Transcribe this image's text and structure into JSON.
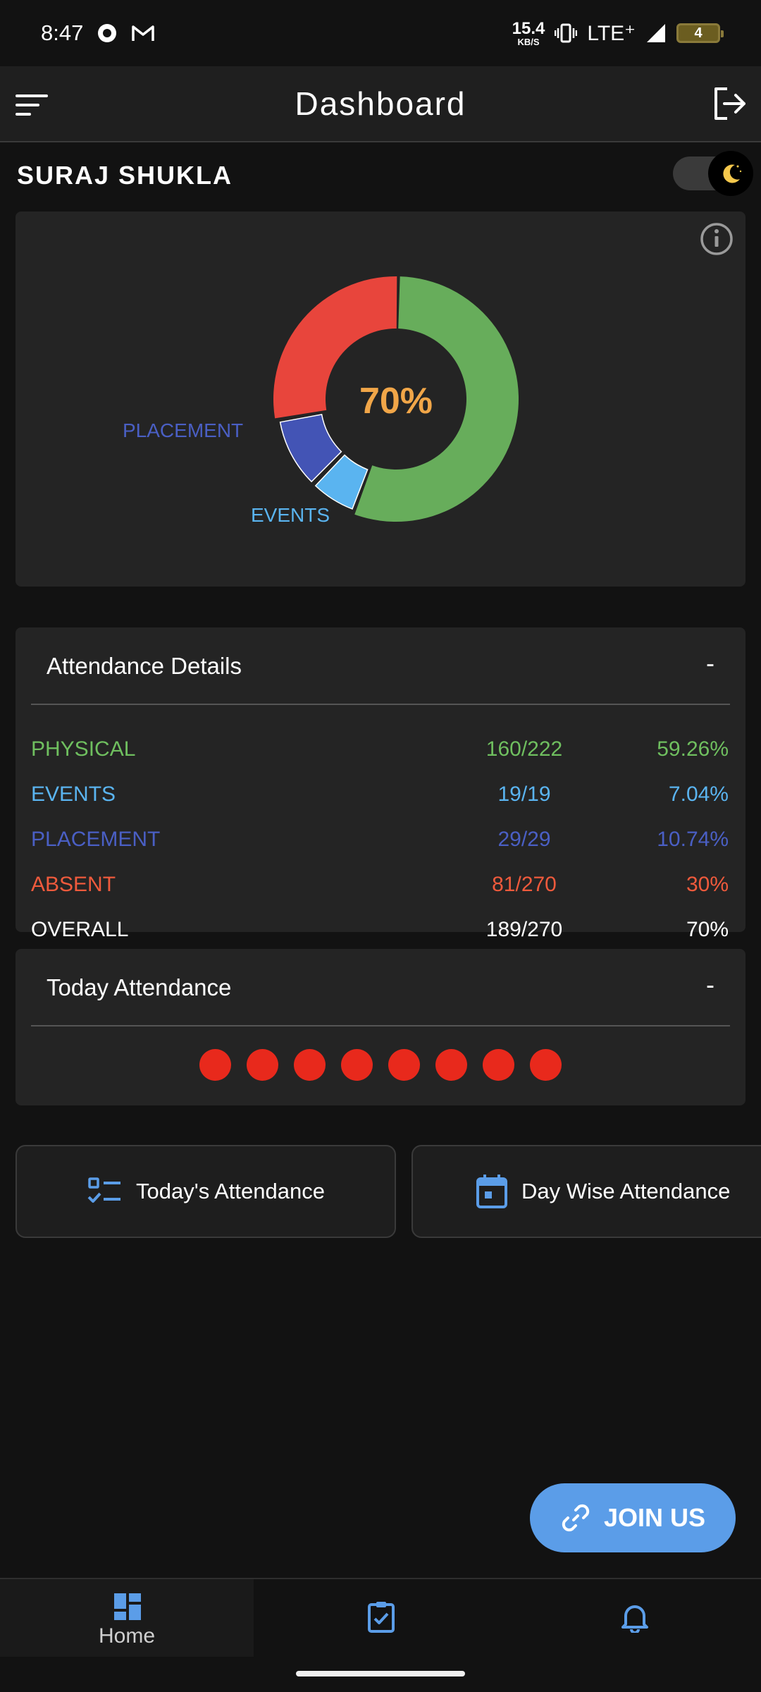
{
  "status_bar": {
    "time": "8:47",
    "net_speed_value": "15.4",
    "net_speed_unit": "KB/S",
    "network": "LTE⁺",
    "battery": "4"
  },
  "app_bar": {
    "title": "Dashboard"
  },
  "user": {
    "name": "SURAJ SHUKLA"
  },
  "chart_data": {
    "type": "pie",
    "center_label": "70%",
    "slices": [
      {
        "name": "PHYSICAL",
        "value": 59.26,
        "color": "#67ad5b",
        "labeled": false
      },
      {
        "name": "EVENTS",
        "value": 7.04,
        "color": "#5ab4f0",
        "labeled": true
      },
      {
        "name": "PLACEMENT",
        "value": 10.74,
        "color": "#4354b5",
        "labeled": true
      },
      {
        "name": "ABSENT",
        "value": 30,
        "color": "#e8453c",
        "labeled": false
      }
    ],
    "labels": {
      "placement": "PLACEMENT",
      "events": "EVENTS"
    }
  },
  "attendance_details": {
    "title": "Attendance Details",
    "collapse_symbol": "-",
    "rows": [
      {
        "label": "PHYSICAL",
        "count": "160/222",
        "percent": "59.26%",
        "color": "#6fbf5f"
      },
      {
        "label": "EVENTS",
        "count": "19/19",
        "percent": "7.04%",
        "color": "#5ab4f0"
      },
      {
        "label": "PLACEMENT",
        "count": "29/29",
        "percent": "10.74%",
        "color": "#4a5fc4"
      },
      {
        "label": "ABSENT",
        "count": "81/270",
        "percent": "30%",
        "color": "#ef5a3c"
      },
      {
        "label": "OVERALL",
        "count": "189/270",
        "percent": "70%",
        "color": "#ffffff"
      }
    ]
  },
  "today_attendance": {
    "title": "Today Attendance",
    "collapse_symbol": "-",
    "dots": 8,
    "dot_color": "#e8291c"
  },
  "actions": {
    "today": "Today's Attendance",
    "day_wise": "Day Wise Attendance"
  },
  "fab": {
    "label": "JOIN US"
  },
  "bottom_nav": {
    "home": "Home"
  },
  "colors": {
    "accent": "#5b9de8",
    "background": "#121212",
    "card": "#242424"
  }
}
